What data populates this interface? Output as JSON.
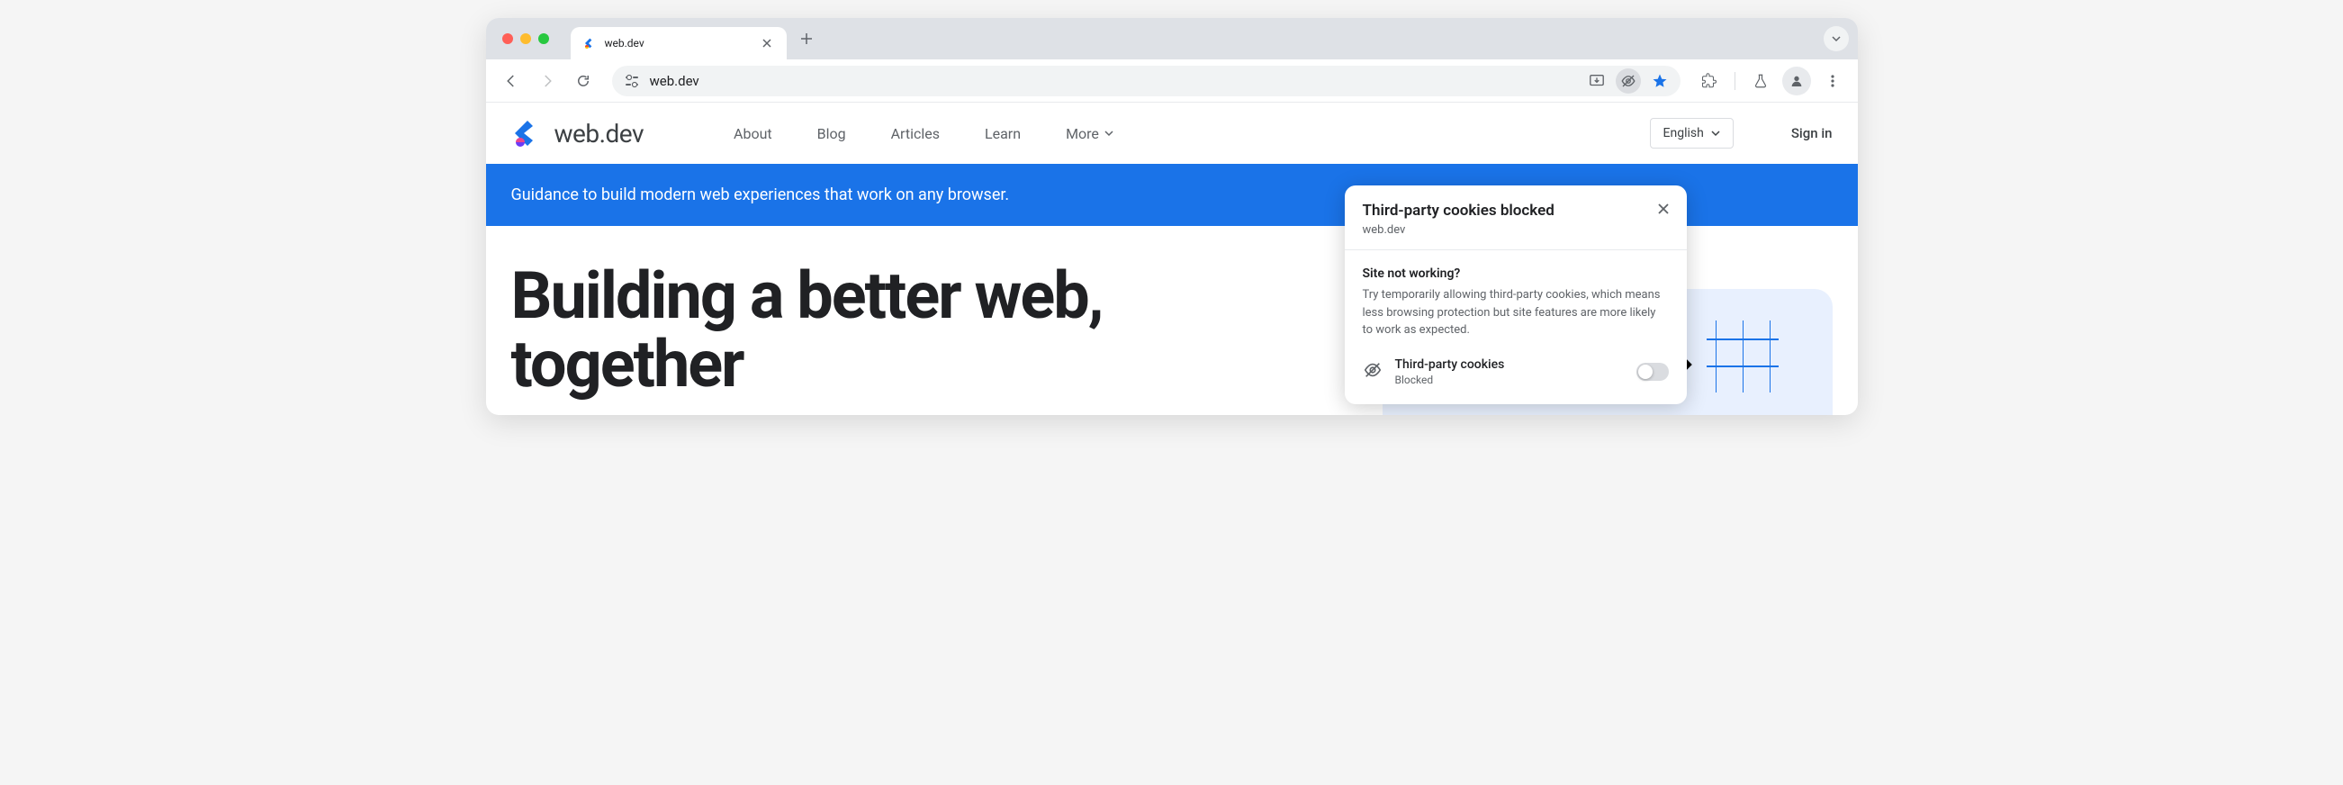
{
  "browser": {
    "tab": {
      "title": "web.dev"
    },
    "url": "web.dev"
  },
  "site": {
    "logo_text": "web.dev",
    "nav": [
      "About",
      "Blog",
      "Articles",
      "Learn",
      "More"
    ],
    "language": "English",
    "sign_in": "Sign in",
    "banner": "Guidance to build modern web experiences that work on any browser.",
    "hero_title": "Building a better web, together"
  },
  "popup": {
    "title": "Third-party cookies blocked",
    "site": "web.dev",
    "subtitle": "Site not working?",
    "description": "Try temporarily allowing third-party cookies, which means less browsing protection but site features are more likely to work as expected.",
    "row_label": "Third-party cookies",
    "row_status": "Blocked"
  }
}
